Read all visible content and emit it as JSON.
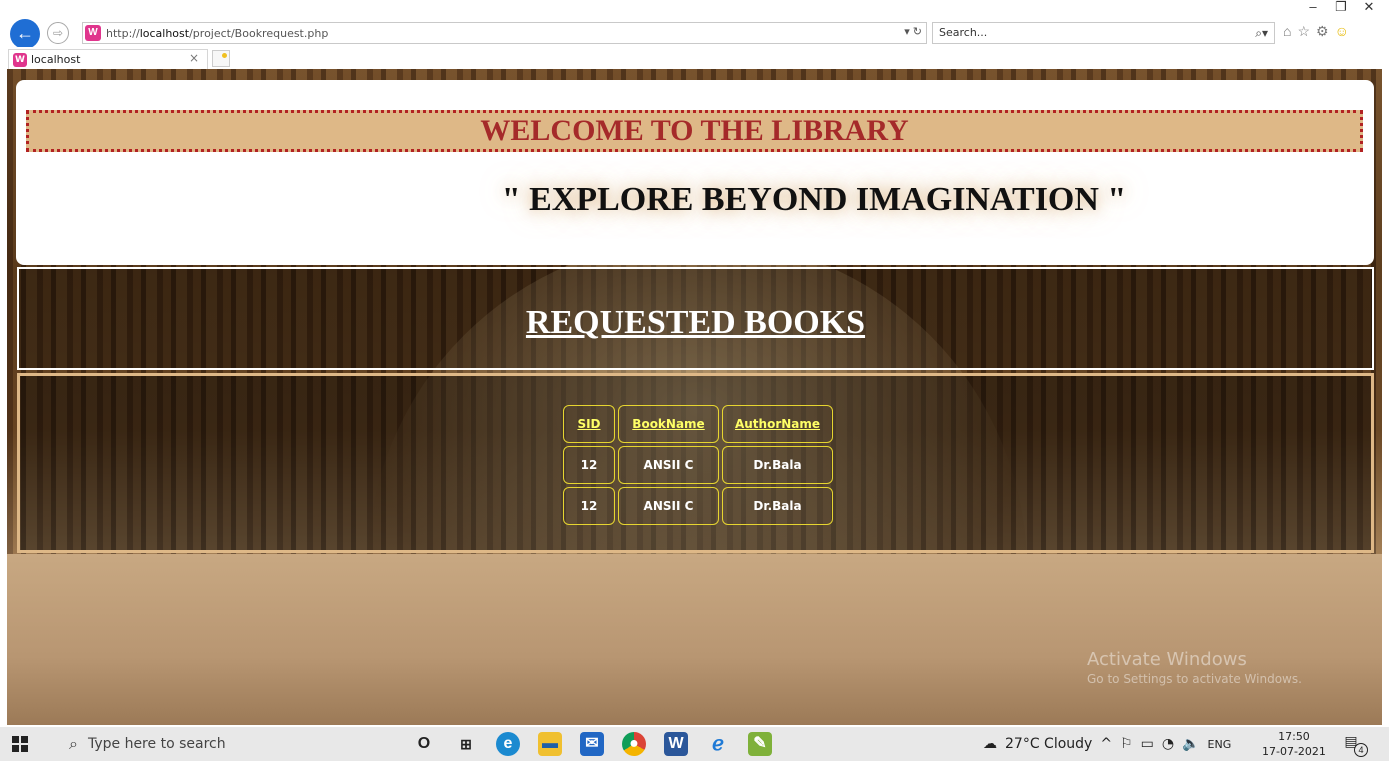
{
  "browser": {
    "url_prefix": "http://",
    "url_host": "localhost",
    "url_path": "/project/Bookrequest.php",
    "addr_controls": "▾ ↻",
    "search_placeholder": "Search...",
    "tab_title": "localhost",
    "window_controls": {
      "minimize": "–",
      "restore": "❐",
      "close": "✕"
    }
  },
  "page": {
    "welcome": "WELCOME TO THE LIBRARY",
    "motto": "\" EXPLORE BEYOND IMAGINATION \"",
    "section_title": "REQUESTED BOOKS",
    "table": {
      "headers": [
        "SID",
        "BookName",
        "AuthorName"
      ],
      "rows": [
        [
          "12",
          "ANSII C",
          "Dr.Bala"
        ],
        [
          "12",
          "ANSII C",
          "Dr.Bala"
        ]
      ]
    },
    "watermark": {
      "line1": "Activate Windows",
      "line2": "Go to Settings to activate Windows."
    }
  },
  "taskbar": {
    "search_placeholder": "Type here to search",
    "weather": "27°C  Cloudy",
    "language": "ENG",
    "time": "17:50",
    "date": "17-07-2021",
    "notification_count": "4"
  },
  "colors": {
    "welcome_band": "#deb887",
    "welcome_text": "#a52a2a",
    "dotted_border": "#b22222",
    "table_border": "#e6d530",
    "table_header_text": "#ffff66"
  }
}
